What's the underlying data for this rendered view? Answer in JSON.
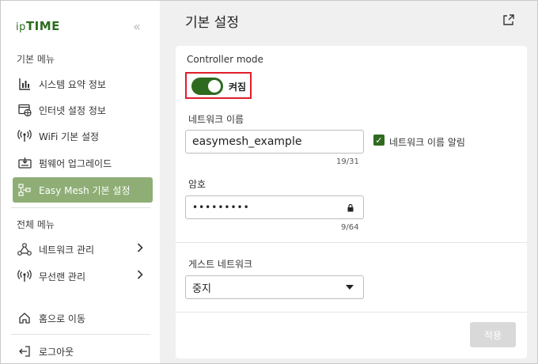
{
  "brand": {
    "logo_prefix": "ip",
    "logo_main": "TIME",
    "accent": "#2e6b1f",
    "active_bg": "#8fae76",
    "highlight": "#e01e2a"
  },
  "sidebar": {
    "collapse_glyph": "«",
    "basic_menu_label": "기본 메뉴",
    "basic_items": [
      {
        "label": "시스템 요약 정보",
        "icon": "bar-chart-icon"
      },
      {
        "label": "인터넷 설정 정보",
        "icon": "globe-window-icon"
      },
      {
        "label": "WiFi 기본 설정",
        "icon": "wifi-antenna-icon"
      },
      {
        "label": "펌웨어 업그레이드",
        "icon": "firmware-icon"
      },
      {
        "label": "Easy Mesh 기본 설정",
        "icon": "mesh-icon",
        "active": true
      }
    ],
    "full_menu_label": "전체 메뉴",
    "full_items": [
      {
        "label": "네트워크 관리",
        "icon": "network-icon"
      },
      {
        "label": "무선랜 관리",
        "icon": "wifi-antenna-icon"
      }
    ],
    "home_label": "홈으로 이동",
    "logout_label": "로그아웃"
  },
  "main": {
    "title": "기본 설정",
    "controller_mode_label": "Controller mode",
    "toggle_state": "켜짐",
    "network_name_label": "네트워크 이름",
    "network_name_value": "easymesh_example",
    "network_name_counter": "19/31",
    "broadcast_checkbox_label": "네트워크 이름 알림",
    "password_label": "암호",
    "password_value": "•••••••••",
    "password_counter": "9/64",
    "guest_network_label": "게스트 네트워크",
    "guest_network_value": "중지",
    "apply_label": "적용"
  }
}
